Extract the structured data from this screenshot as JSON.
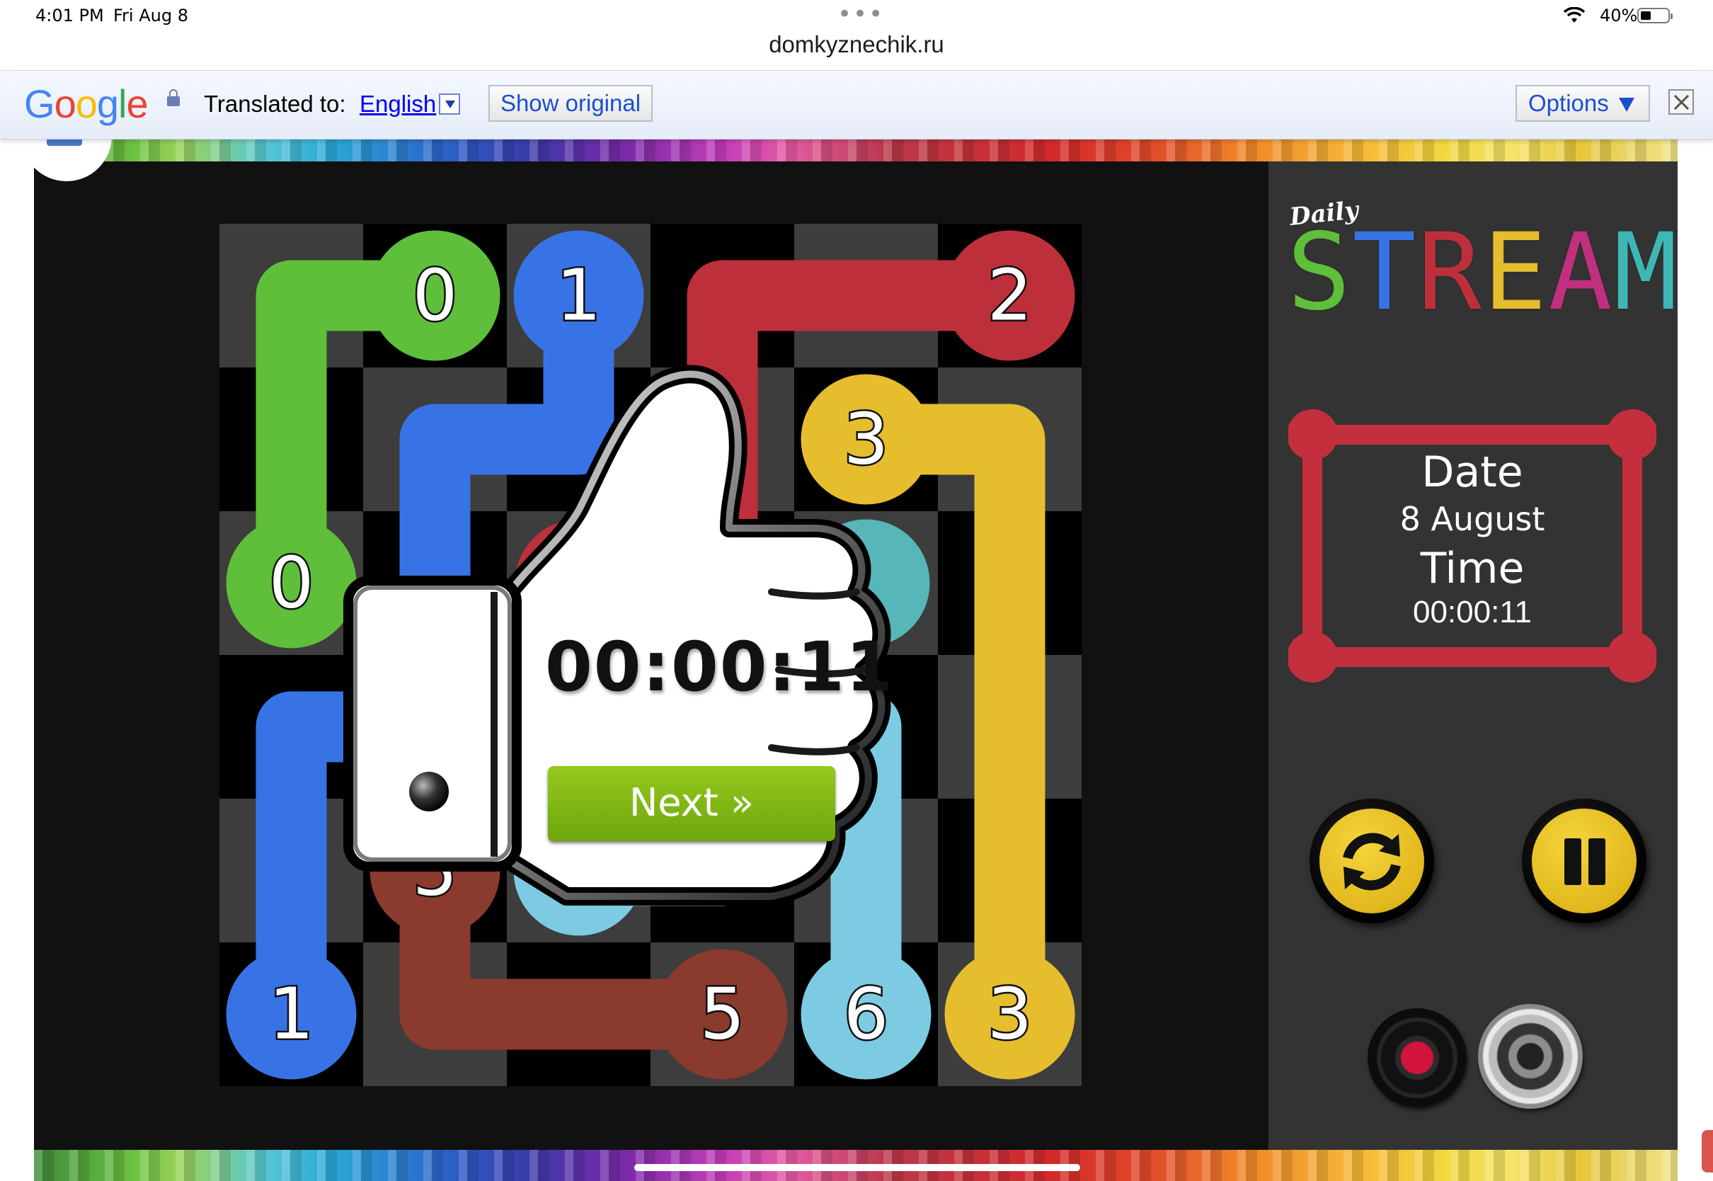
{
  "status_bar": {
    "time": "4:01 PM",
    "date": "Fri Aug 8",
    "battery": "40%",
    "battery_level": 0.4,
    "url": "domkyznechik.ru"
  },
  "translate_bar": {
    "logo": "Google",
    "translated_label": "Translated to:",
    "language": "English",
    "show_original": "Show original",
    "options": "Options"
  },
  "game": {
    "grid_size": 6,
    "colors": {
      "green": "#5fbe3a",
      "blue": "#3873e6",
      "red": "#be2f3c",
      "yellow": "#e6bd2c",
      "teal": "#56b6b8",
      "brown": "#8b3a2e",
      "lightblue": "#7dcbe3"
    },
    "endpoints": [
      {
        "label": "0",
        "color": "green",
        "row": 0,
        "col": 1
      },
      {
        "label": "0",
        "color": "green",
        "row": 2,
        "col": 0
      },
      {
        "label": "1",
        "color": "blue",
        "row": 0,
        "col": 2
      },
      {
        "label": "1",
        "color": "blue",
        "row": 5,
        "col": 0
      },
      {
        "label": "2",
        "color": "red",
        "row": 0,
        "col": 5
      },
      {
        "label": "3",
        "color": "yellow",
        "row": 1,
        "col": 4
      },
      {
        "label": "3",
        "color": "yellow",
        "row": 5,
        "col": 5
      },
      {
        "label": "5",
        "color": "brown",
        "row": 5,
        "col": 3
      },
      {
        "label": "5",
        "color": "brown",
        "row": 4,
        "col": 1
      },
      {
        "label": "6",
        "color": "lightblue",
        "row": 5,
        "col": 4
      },
      {
        "label": "6",
        "color": "lightblue",
        "row": 4,
        "col": 2
      }
    ],
    "hidden_endpoints": [
      {
        "color": "red",
        "row": 2,
        "col": 2
      },
      {
        "color": "teal",
        "row": 2,
        "col": 4
      }
    ],
    "paths": [
      {
        "color": "green",
        "cells": [
          [
            0,
            1
          ],
          [
            0,
            0
          ],
          [
            1,
            0
          ],
          [
            2,
            0
          ]
        ]
      },
      {
        "color": "blue",
        "cells": [
          [
            0,
            2
          ],
          [
            1,
            2
          ],
          [
            1,
            1
          ],
          [
            2,
            1
          ],
          [
            3,
            1
          ],
          [
            3,
            0
          ],
          [
            4,
            0
          ],
          [
            5,
            0
          ]
        ]
      },
      {
        "color": "red",
        "cells": [
          [
            0,
            5
          ],
          [
            0,
            4
          ],
          [
            0,
            3
          ],
          [
            1,
            3
          ],
          [
            2,
            3
          ],
          [
            2,
            2
          ]
        ]
      },
      {
        "color": "yellow",
        "cells": [
          [
            1,
            4
          ],
          [
            1,
            5
          ],
          [
            2,
            5
          ],
          [
            3,
            5
          ],
          [
            4,
            5
          ],
          [
            5,
            5
          ]
        ]
      },
      {
        "color": "brown",
        "cells": [
          [
            4,
            1
          ],
          [
            5,
            1
          ],
          [
            5,
            2
          ],
          [
            5,
            3
          ]
        ]
      },
      {
        "color": "lightblue",
        "cells": [
          [
            5,
            4
          ],
          [
            4,
            4
          ],
          [
            3,
            4
          ],
          [
            3,
            3
          ],
          [
            4,
            3
          ],
          [
            4,
            2
          ]
        ]
      }
    ]
  },
  "side_panel": {
    "logo_daily": "Daily",
    "logo_letters": [
      {
        "char": "S",
        "color": "#5fbe3a"
      },
      {
        "char": "T",
        "color": "#3873e6"
      },
      {
        "char": "R",
        "color": "#be2f3c"
      },
      {
        "char": "E",
        "color": "#e6bd2c"
      },
      {
        "char": "A",
        "color": "#c0307e"
      },
      {
        "char": "M",
        "color": "#3fb6b6"
      }
    ],
    "date_label": "Date",
    "date_value": "8 August",
    "time_label": "Time",
    "time_value": "00:00:11",
    "frame_color": "#c32f3c",
    "buttons": {
      "restart_icon": "refresh-icon",
      "pause_icon": "pause-icon",
      "record_icon": "record-icon",
      "sound_icon": "speaker-icon"
    }
  },
  "win_dialog": {
    "time": "00:00:11",
    "next_label": "Next »",
    "icon": "thumbs-up-icon"
  }
}
